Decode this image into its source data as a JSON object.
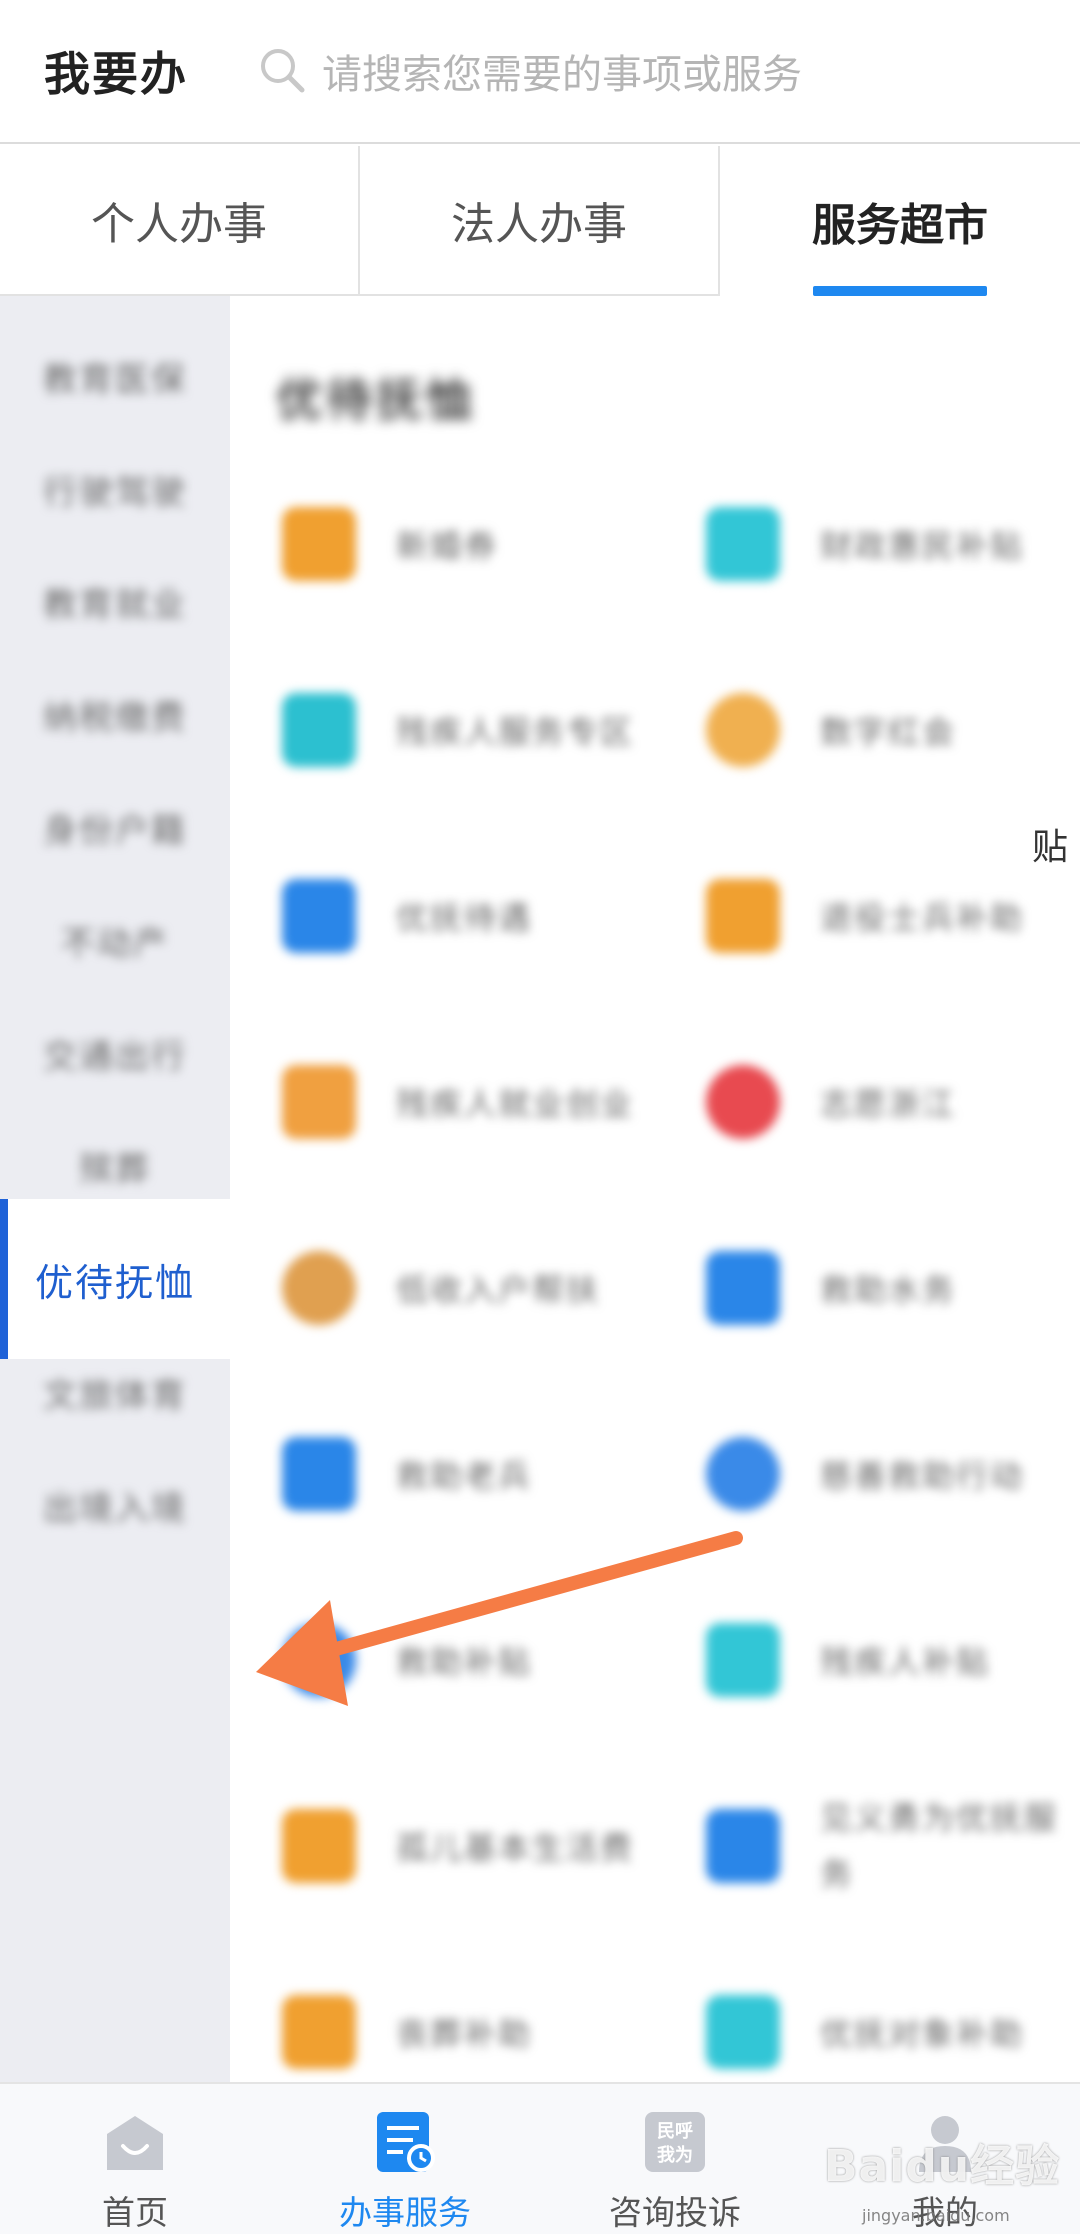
{
  "header": {
    "title": "我要办",
    "search_placeholder": "请搜索您需要的事项或服务"
  },
  "tabs": [
    {
      "label": "个人办事",
      "active": false
    },
    {
      "label": "法人办事",
      "active": false
    },
    {
      "label": "服务超市",
      "active": true
    }
  ],
  "sidebar": {
    "items": [
      {
        "label": "教育医保",
        "active": false
      },
      {
        "label": "行驶驾驶",
        "active": false
      },
      {
        "label": "教育就业",
        "active": false
      },
      {
        "label": "纳税缴费",
        "active": false
      },
      {
        "label": "身份户籍",
        "active": false
      },
      {
        "label": "不动产",
        "active": false
      },
      {
        "label": "交通出行",
        "active": false
      },
      {
        "label": "殡葬",
        "active": false
      },
      {
        "label": "优待抚恤",
        "active": true
      },
      {
        "label": "文旅体育",
        "active": false
      },
      {
        "label": "出境入境",
        "active": false
      }
    ]
  },
  "main": {
    "section_title": "优待抚恤",
    "edge_text": "贴",
    "services": [
      {
        "label": "新婚券",
        "icon": "certificate-icon",
        "color": "#f0a030"
      },
      {
        "label": "财政惠民补贴",
        "icon": "grid-icon",
        "color": "#32c6d6"
      },
      {
        "label": "残疾人服务专区",
        "icon": "wheelchair-icon",
        "color": "#2cc0d0"
      },
      {
        "label": "数字红会",
        "icon": "heart-icon",
        "color": "#f0b050"
      },
      {
        "label": "优抚待遇",
        "icon": "certificate-icon",
        "color": "#2a86e8"
      },
      {
        "label": "退役士兵补助",
        "icon": "certificate-icon",
        "color": "#f0a030"
      },
      {
        "label": "残疾人就业创业",
        "icon": "mail-icon",
        "color": "#f0a040"
      },
      {
        "label": "志愿浙江",
        "icon": "pin-icon",
        "color": "#e84a50"
      },
      {
        "label": "低收入户帮扶",
        "icon": "bag-icon",
        "color": "#e0a050"
      },
      {
        "label": "救助水务",
        "icon": "tap-icon",
        "color": "#2a86e8"
      },
      {
        "label": "救助老兵",
        "icon": "hands-icon",
        "color": "#2a86e8"
      },
      {
        "label": "慈善救助行动",
        "icon": "globe-icon",
        "color": "#3a8ae8"
      },
      {
        "label": "救助补贴",
        "icon": "doc-icon",
        "color": "#3a8ae8"
      },
      {
        "label": "残疾人补贴",
        "icon": "grid-icon",
        "color": "#32c6d6"
      },
      {
        "label": "孤儿基本生活费",
        "icon": "certificate-icon",
        "color": "#f0a030"
      },
      {
        "label": "见义勇为优抚服务",
        "icon": "grid-icon",
        "color": "#2a86e8"
      },
      {
        "label": "丧葬补助",
        "icon": "certificate-icon",
        "color": "#f0a030"
      },
      {
        "label": "优抚对象补助",
        "icon": "grid-icon",
        "color": "#32c6d6"
      }
    ]
  },
  "bottom_nav": [
    {
      "label": "首页",
      "icon": "home-icon",
      "active": false
    },
    {
      "label": "办事服务",
      "icon": "service-doc-icon",
      "active": true
    },
    {
      "label": "咨询投诉",
      "icon": "complaint-icon",
      "active": false,
      "icon_text": "民呼我为"
    },
    {
      "label": "我的",
      "icon": "user-icon",
      "active": false
    }
  ],
  "watermark": {
    "text": "Baidu经验",
    "sub": "jingyan.baidu.com"
  },
  "colors": {
    "accent": "#1e88f0",
    "active_text": "#1f5fcf",
    "sidebar_bg": "#ecedf2",
    "arrow": "#f57c45"
  }
}
